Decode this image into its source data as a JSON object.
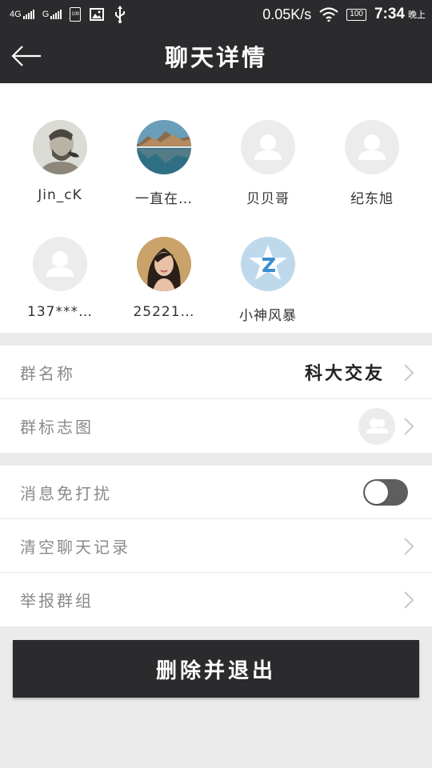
{
  "statusbar": {
    "signal1": "4G",
    "signal2": "G",
    "sim_label": "100",
    "speed": "0.05K/s",
    "battery": "100",
    "time": "7:34",
    "ampm": "晚上"
  },
  "header": {
    "title": "聊天详情",
    "back_icon": "back-arrow-icon"
  },
  "members": [
    {
      "name": "Jin_cK",
      "avatar": "photo-man"
    },
    {
      "name": "一直在…",
      "avatar": "photo-landscape"
    },
    {
      "name": "贝贝哥",
      "avatar": "default-user"
    },
    {
      "name": "纪东旭",
      "avatar": "default-user"
    },
    {
      "name": "137***…",
      "avatar": "default-user"
    },
    {
      "name": "25221…",
      "avatar": "photo-woman"
    },
    {
      "name": "小神风暴",
      "avatar": "qzone-logo"
    }
  ],
  "group_info": {
    "name_label": "群名称",
    "name_value": "科大交友",
    "logo_label": "群标志图"
  },
  "settings": {
    "mute_label": "消息免打扰",
    "mute_on": false,
    "clear_label": "清空聊天记录",
    "report_label": "举报群组"
  },
  "actions": {
    "delete_exit": "删除并退出"
  },
  "colors": {
    "bar": "#2b2b2e",
    "page_bg": "#ebebeb",
    "toggle_off": "#5e5e5e"
  }
}
